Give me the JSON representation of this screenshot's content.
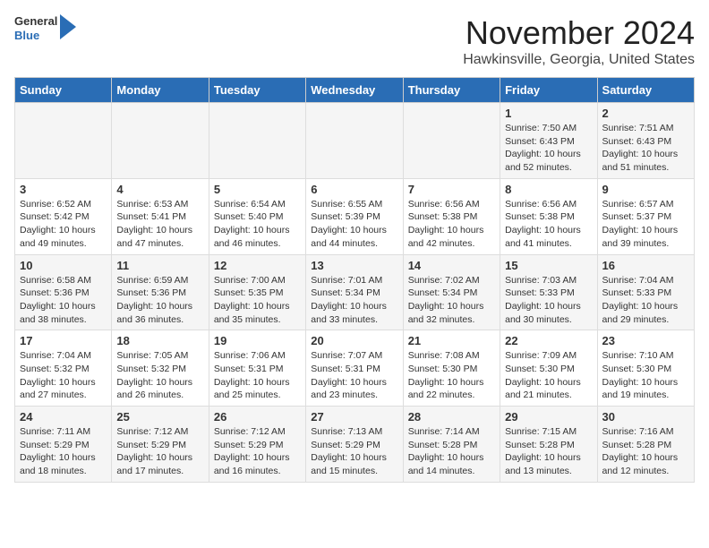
{
  "header": {
    "logo": {
      "general": "General",
      "blue": "Blue"
    },
    "month": "November 2024",
    "location": "Hawkinsville, Georgia, United States"
  },
  "days_of_week": [
    "Sunday",
    "Monday",
    "Tuesday",
    "Wednesday",
    "Thursday",
    "Friday",
    "Saturday"
  ],
  "weeks": [
    [
      {
        "day": "",
        "info": ""
      },
      {
        "day": "",
        "info": ""
      },
      {
        "day": "",
        "info": ""
      },
      {
        "day": "",
        "info": ""
      },
      {
        "day": "",
        "info": ""
      },
      {
        "day": "1",
        "info": "Sunrise: 7:50 AM\nSunset: 6:43 PM\nDaylight: 10 hours\nand 52 minutes."
      },
      {
        "day": "2",
        "info": "Sunrise: 7:51 AM\nSunset: 6:43 PM\nDaylight: 10 hours\nand 51 minutes."
      }
    ],
    [
      {
        "day": "3",
        "info": "Sunrise: 6:52 AM\nSunset: 5:42 PM\nDaylight: 10 hours\nand 49 minutes."
      },
      {
        "day": "4",
        "info": "Sunrise: 6:53 AM\nSunset: 5:41 PM\nDaylight: 10 hours\nand 47 minutes."
      },
      {
        "day": "5",
        "info": "Sunrise: 6:54 AM\nSunset: 5:40 PM\nDaylight: 10 hours\nand 46 minutes."
      },
      {
        "day": "6",
        "info": "Sunrise: 6:55 AM\nSunset: 5:39 PM\nDaylight: 10 hours\nand 44 minutes."
      },
      {
        "day": "7",
        "info": "Sunrise: 6:56 AM\nSunset: 5:38 PM\nDaylight: 10 hours\nand 42 minutes."
      },
      {
        "day": "8",
        "info": "Sunrise: 6:56 AM\nSunset: 5:38 PM\nDaylight: 10 hours\nand 41 minutes."
      },
      {
        "day": "9",
        "info": "Sunrise: 6:57 AM\nSunset: 5:37 PM\nDaylight: 10 hours\nand 39 minutes."
      }
    ],
    [
      {
        "day": "10",
        "info": "Sunrise: 6:58 AM\nSunset: 5:36 PM\nDaylight: 10 hours\nand 38 minutes."
      },
      {
        "day": "11",
        "info": "Sunrise: 6:59 AM\nSunset: 5:36 PM\nDaylight: 10 hours\nand 36 minutes."
      },
      {
        "day": "12",
        "info": "Sunrise: 7:00 AM\nSunset: 5:35 PM\nDaylight: 10 hours\nand 35 minutes."
      },
      {
        "day": "13",
        "info": "Sunrise: 7:01 AM\nSunset: 5:34 PM\nDaylight: 10 hours\nand 33 minutes."
      },
      {
        "day": "14",
        "info": "Sunrise: 7:02 AM\nSunset: 5:34 PM\nDaylight: 10 hours\nand 32 minutes."
      },
      {
        "day": "15",
        "info": "Sunrise: 7:03 AM\nSunset: 5:33 PM\nDaylight: 10 hours\nand 30 minutes."
      },
      {
        "day": "16",
        "info": "Sunrise: 7:04 AM\nSunset: 5:33 PM\nDaylight: 10 hours\nand 29 minutes."
      }
    ],
    [
      {
        "day": "17",
        "info": "Sunrise: 7:04 AM\nSunset: 5:32 PM\nDaylight: 10 hours\nand 27 minutes."
      },
      {
        "day": "18",
        "info": "Sunrise: 7:05 AM\nSunset: 5:32 PM\nDaylight: 10 hours\nand 26 minutes."
      },
      {
        "day": "19",
        "info": "Sunrise: 7:06 AM\nSunset: 5:31 PM\nDaylight: 10 hours\nand 25 minutes."
      },
      {
        "day": "20",
        "info": "Sunrise: 7:07 AM\nSunset: 5:31 PM\nDaylight: 10 hours\nand 23 minutes."
      },
      {
        "day": "21",
        "info": "Sunrise: 7:08 AM\nSunset: 5:30 PM\nDaylight: 10 hours\nand 22 minutes."
      },
      {
        "day": "22",
        "info": "Sunrise: 7:09 AM\nSunset: 5:30 PM\nDaylight: 10 hours\nand 21 minutes."
      },
      {
        "day": "23",
        "info": "Sunrise: 7:10 AM\nSunset: 5:30 PM\nDaylight: 10 hours\nand 19 minutes."
      }
    ],
    [
      {
        "day": "24",
        "info": "Sunrise: 7:11 AM\nSunset: 5:29 PM\nDaylight: 10 hours\nand 18 minutes."
      },
      {
        "day": "25",
        "info": "Sunrise: 7:12 AM\nSunset: 5:29 PM\nDaylight: 10 hours\nand 17 minutes."
      },
      {
        "day": "26",
        "info": "Sunrise: 7:12 AM\nSunset: 5:29 PM\nDaylight: 10 hours\nand 16 minutes."
      },
      {
        "day": "27",
        "info": "Sunrise: 7:13 AM\nSunset: 5:29 PM\nDaylight: 10 hours\nand 15 minutes."
      },
      {
        "day": "28",
        "info": "Sunrise: 7:14 AM\nSunset: 5:28 PM\nDaylight: 10 hours\nand 14 minutes."
      },
      {
        "day": "29",
        "info": "Sunrise: 7:15 AM\nSunset: 5:28 PM\nDaylight: 10 hours\nand 13 minutes."
      },
      {
        "day": "30",
        "info": "Sunrise: 7:16 AM\nSunset: 5:28 PM\nDaylight: 10 hours\nand 12 minutes."
      }
    ]
  ]
}
